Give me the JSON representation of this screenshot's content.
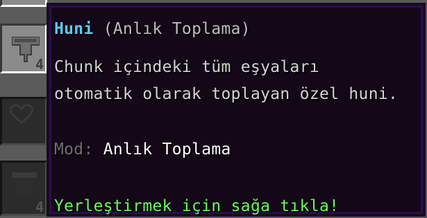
{
  "inventory": {
    "slots": [
      {
        "count": "4"
      },
      {
        "count": "4"
      }
    ]
  },
  "tooltip": {
    "title": "Huni",
    "subtitle": "(Anlık Toplama)",
    "description": [
      "Chunk içindeki tüm eşyaları",
      "otomatik olarak toplayan özel huni."
    ],
    "mode_label": "Mod:",
    "mode_value": "Anlık Toplama",
    "hint": "Yerleştirmek için sağa tıkla!"
  },
  "colors": {
    "title": "#55ccff",
    "subtitle": "#bdbdbd",
    "description": "#d2d2d2",
    "mode_label": "#6e6e6e",
    "mode_value": "#ffffff",
    "hint": "#66ff55",
    "tooltip_bg": "#120416",
    "tooltip_border": "#2b0d52"
  },
  "icons": [
    "hopper-icon",
    "heart-icon"
  ]
}
